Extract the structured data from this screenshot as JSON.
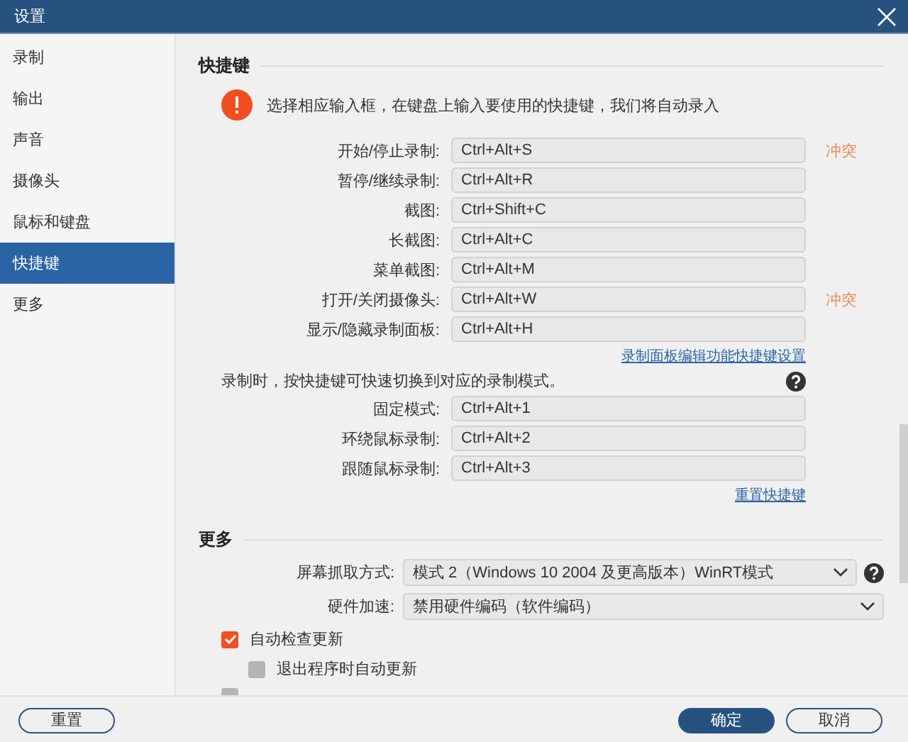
{
  "window": {
    "title": "设置"
  },
  "sidebar": {
    "items": [
      {
        "label": "录制",
        "selected": false
      },
      {
        "label": "输出",
        "selected": false
      },
      {
        "label": "声音",
        "selected": false
      },
      {
        "label": "摄像头",
        "selected": false
      },
      {
        "label": "鼠标和键盘",
        "selected": false
      },
      {
        "label": "快捷键",
        "selected": true
      },
      {
        "label": "更多",
        "selected": false
      }
    ]
  },
  "shortcuts": {
    "title": "快捷键",
    "notice": "选择相应输入框，在键盘上输入要使用的快捷键，我们将自动录入",
    "rows": [
      {
        "label": "开始/停止录制:",
        "value": "Ctrl+Alt+S",
        "conflict": "冲突"
      },
      {
        "label": "暂停/继续录制:",
        "value": "Ctrl+Alt+R"
      },
      {
        "label": "截图:",
        "value": "Ctrl+Shift+C"
      },
      {
        "label": "长截图:",
        "value": "Ctrl+Alt+C"
      },
      {
        "label": "菜单截图:",
        "value": "Ctrl+Alt+M"
      },
      {
        "label": "打开/关闭摄像头:",
        "value": "Ctrl+Alt+W",
        "conflict": "冲突"
      },
      {
        "label": "显示/隐藏录制面板:",
        "value": "Ctrl+Alt+H"
      }
    ],
    "panel_link": "录制面板编辑功能快捷键设置",
    "mode_note": "录制时，按快捷键可快速切换到对应的录制模式。",
    "mode_rows": [
      {
        "label": "固定模式:",
        "value": "Ctrl+Alt+1"
      },
      {
        "label": "环绕鼠标录制:",
        "value": "Ctrl+Alt+2"
      },
      {
        "label": "跟随鼠标录制:",
        "value": "Ctrl+Alt+3"
      }
    ],
    "reset_link": "重置快捷键"
  },
  "more": {
    "title": "更多",
    "dropdowns": [
      {
        "label": "屏幕抓取方式:",
        "value": "模式 2（Windows 10 2004 及更高版本）WinRT模式",
        "help": true
      },
      {
        "label": "硬件加速:",
        "value": "禁用硬件编码（软件编码）",
        "help": false
      }
    ],
    "checkboxes": [
      {
        "label": "自动检查更新",
        "checked": true,
        "children": [
          {
            "label": "退出程序时自动更新",
            "checked": false
          }
        ]
      },
      {
        "checked": false
      }
    ]
  },
  "footer": {
    "reset": "重置",
    "ok": "确定",
    "cancel": "取消"
  }
}
